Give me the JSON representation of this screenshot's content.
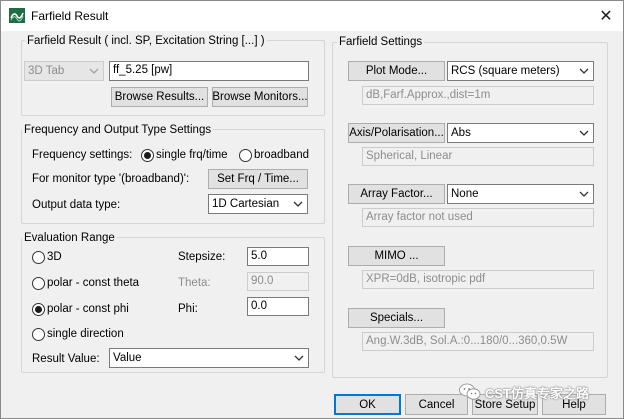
{
  "window": {
    "title": "Farfield Result",
    "icons": {
      "app": "cst-app-icon",
      "close": "close-icon"
    },
    "close_glyph": "✕"
  },
  "farfield_result": {
    "title": "Farfield Result ( incl. SP, Excitation String [...] )",
    "view_select": "3D Tab",
    "result_name": "ff_5.25 [pw]",
    "browse_results": "Browse Results...",
    "browse_monitors": "Browse Monitors..."
  },
  "frequency": {
    "title": "Frequency and Output Type Settings",
    "freq_label": "Frequency settings:",
    "single_label": "single frq/time",
    "broadband_label": "broadband",
    "selected": "single frq/time",
    "monitor_label": "For monitor type '(broadband)':",
    "set_frq_button": "Set Frq / Time...",
    "output_label": "Output data type:",
    "output_value": "1D Cartesian"
  },
  "evaluation": {
    "title": "Evaluation Range",
    "options": [
      "3D",
      "polar - const theta",
      "polar - const phi",
      "single direction"
    ],
    "selected": "polar - const phi",
    "stepsize_label": "Stepsize:",
    "stepsize_value": "5.0",
    "theta_label": "Theta:",
    "theta_value": "90.0",
    "phi_label": "Phi:",
    "phi_value": "0.0",
    "result_value_label": "Result Value:",
    "result_value": "Value"
  },
  "farfield_settings": {
    "title": "Farfield Settings",
    "plot_mode_button": "Plot Mode...",
    "plot_mode_value": "RCS (square meters)",
    "plot_mode_info": "dB,Farf.Approx.,dist=1m",
    "axis_button": "Axis/Polarisation...",
    "axis_value": "Abs",
    "axis_info": "Spherical, Linear",
    "array_button": "Array Factor...",
    "array_value": "None",
    "array_info": "Array factor not used",
    "mimo_button": "MIMO ...",
    "mimo_info": "XPR=0dB, isotropic pdf",
    "specials_button": "Specials...",
    "specials_info": "Ang.W.3dB, Sol.A.:0...180/0...360,0.5W"
  },
  "footer": {
    "ok": "OK",
    "cancel": "Cancel",
    "store_setup": "Store Setup",
    "help": "Help"
  },
  "watermark": {
    "text": "CST仿真专家之路",
    "icon": "wechat-icon"
  }
}
